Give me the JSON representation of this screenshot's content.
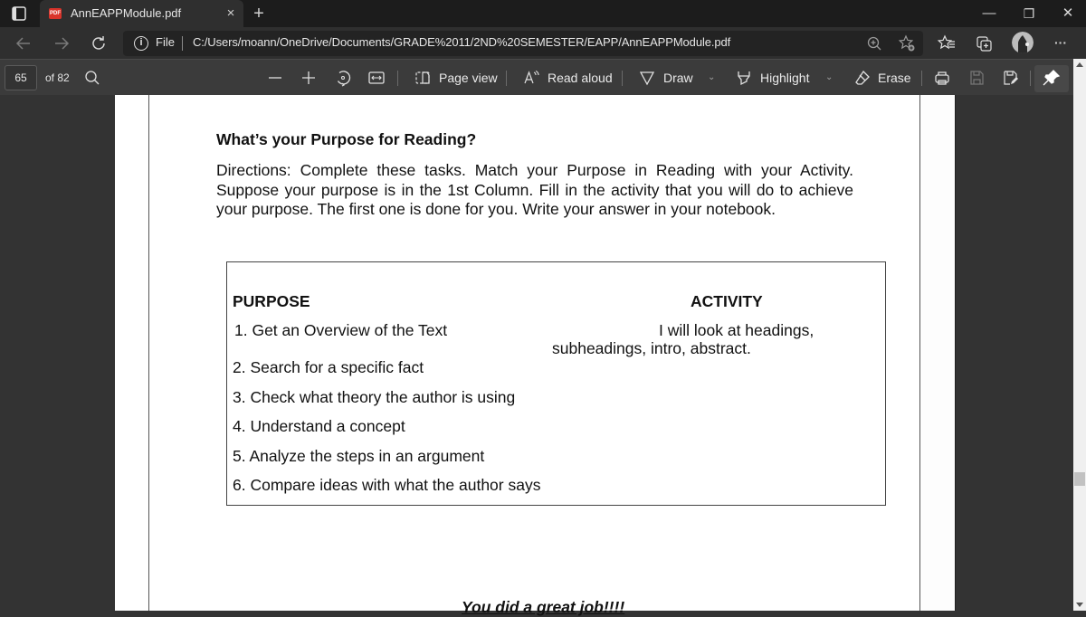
{
  "browser": {
    "tab_title": "AnnEAPPModule.pdf",
    "tab_icon_label": "PDF",
    "tab_close": "×",
    "new_tab": "+",
    "window_controls": {
      "minimize": "—",
      "restore": "❐",
      "close": "✕"
    },
    "address": {
      "scheme_label": "File",
      "url": "C:/Users/moann/OneDrive/Documents/GRADE%2011/2ND%20SEMESTER/EAPP/AnnEAPPModule.pdf"
    },
    "icons": [
      "back-icon",
      "forward-icon",
      "refresh-icon",
      "site-info-icon",
      "zoom-icon",
      "add-favorite-icon",
      "favorites-icon",
      "collections-icon",
      "profile-avatar",
      "more-icon"
    ],
    "more_label": "···"
  },
  "pdf_toolbar": {
    "current_page": "65",
    "page_total_label": "of 82",
    "zoom_out": "—",
    "zoom_in": "+",
    "page_view_label": "Page view",
    "read_aloud_label": "Read aloud",
    "draw_label": "Draw",
    "highlight_label": "Highlight",
    "erase_label": "Erase",
    "chevron": "⌄"
  },
  "document": {
    "heading": "What’s your Purpose for Reading?",
    "directions": "Directions: Complete these tasks. Match your Purpose in Reading with your Activity. Suppose your purpose is in the 1st Column. Fill in the activity that you will do to achieve your purpose. The first one is done for you. Write your answer in your notebook.",
    "table": {
      "headers": {
        "purpose": "PURPOSE",
        "activity": "ACTIVITY"
      },
      "rows": [
        {
          "purpose": "1. Get an Overview of the Text",
          "activity_line1": "I will look at headings,",
          "activity_line2": "subheadings, intro, abstract."
        },
        {
          "purpose": "2. Search for a specific fact"
        },
        {
          "purpose": "3. Check what theory the author is using"
        },
        {
          "purpose": "4. Understand a concept"
        },
        {
          "purpose": "5. Analyze the steps in an argument"
        },
        {
          "purpose": "6. Compare ideas with what the author says"
        }
      ]
    },
    "footer": "You did a great job!!!!"
  }
}
